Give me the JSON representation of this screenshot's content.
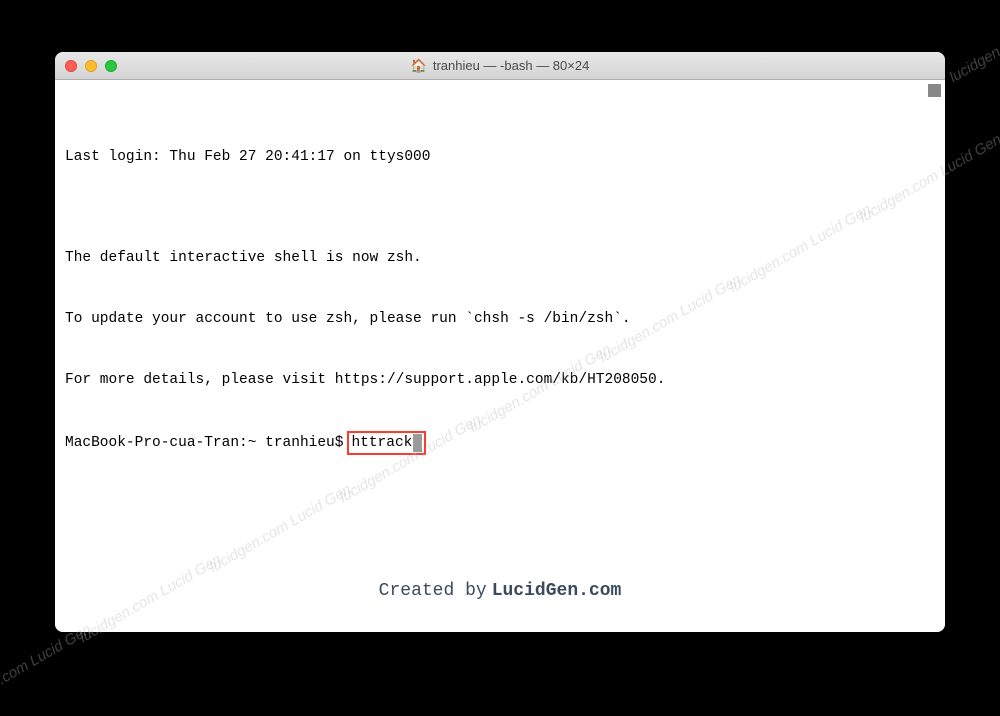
{
  "window": {
    "title": "tranhieu — -bash — 80×24",
    "home_icon": "🏠"
  },
  "terminal": {
    "lines": [
      "Last login: Thu Feb 27 20:41:17 on ttys000",
      "",
      "The default interactive shell is now zsh.",
      "To update your account to use zsh, please run `chsh -s /bin/zsh`.",
      "For more details, please visit https://support.apple.com/kb/HT208050."
    ],
    "prompt": "MacBook-Pro-cua-Tran:~ tranhieu$",
    "command": "httrack"
  },
  "footer": {
    "prefix": "Created by",
    "brand": "LucidGen.com"
  },
  "watermark": {
    "text": "lucidgen.com   Lucid Gen"
  }
}
